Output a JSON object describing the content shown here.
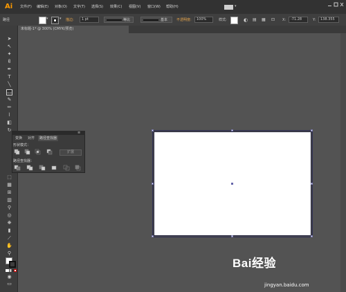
{
  "app": {
    "logo": "Ai"
  },
  "menu": [
    {
      "label": "文件(F)"
    },
    {
      "label": "编辑(E)"
    },
    {
      "label": "对象(O)"
    },
    {
      "label": "文字(T)"
    },
    {
      "label": "选择(S)"
    },
    {
      "label": "效果(C)"
    },
    {
      "label": "视图(V)"
    },
    {
      "label": "窗口(W)"
    },
    {
      "label": "帮助(H)"
    }
  ],
  "control_bar": {
    "object_label": "路径",
    "stroke_label": "描边:",
    "stroke_width": "1 pt",
    "profile_label": "等比",
    "brush_label": "基本",
    "opacity_label": "不透明度:",
    "opacity_value": "100%",
    "style_label": "样式:",
    "x_label": "X:",
    "x_value": "-71.28",
    "y_label": "Y:",
    "y_value": "138.355"
  },
  "document": {
    "tab_label": "未标题-1* @ 300% (CMYK/预览)"
  },
  "pathfinder": {
    "tabs": [
      "变换",
      "对齐",
      "路径查找器"
    ],
    "active_tab": 2,
    "shape_modes_label": "形状模式：",
    "expand_label": "扩展",
    "pathfinders_label": "路径查找器："
  },
  "watermark": {
    "brand": "Bai经验",
    "url": "jingyan.baidu.com"
  }
}
